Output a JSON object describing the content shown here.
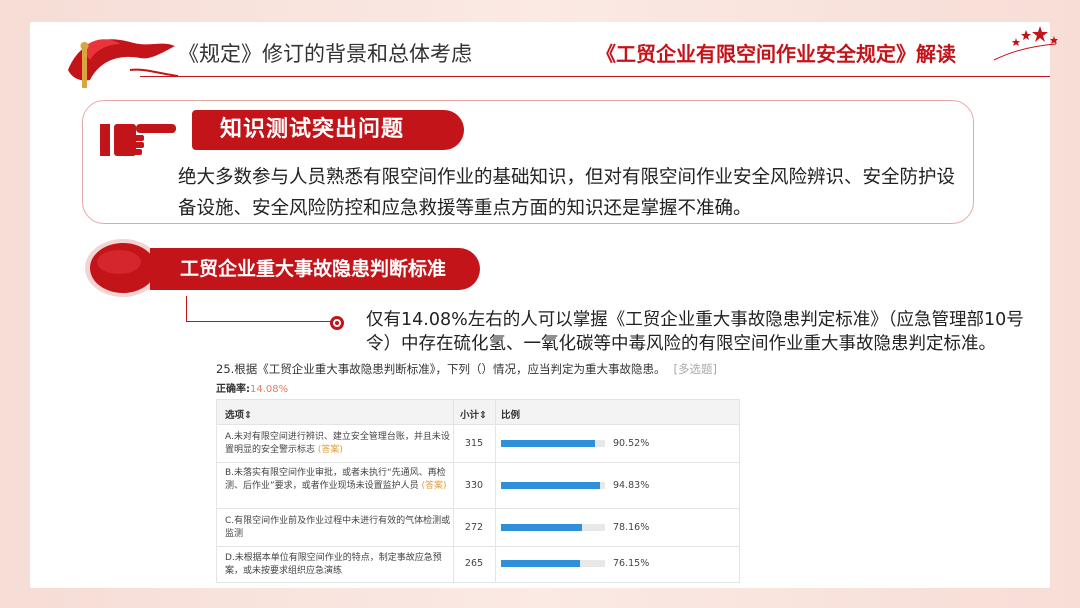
{
  "header": {
    "section_title": "《规定》修订的背景和总体考虑",
    "doc_title": "《工贸企业有限空间作业安全规定》解读"
  },
  "knowledge": {
    "banner": "知识测试突出问题",
    "text": "绝大多数参与人员熟悉有限空间作业的基础知识，但对有限空间作业安全风险辨识、安全防护设备设施、安全风险防控和应急救援等重点方面的知识还是掌握不准确。"
  },
  "standard": {
    "banner": "工贸企业重大事故隐患判断标准",
    "text": "仅有14.08%左右的人可以掌握《工贸企业重大事故隐患判定标准》（应急管理部10号令）中存在硫化氢、一氧化碳等中毒风险的有限空间作业重大事故隐患判定标准。"
  },
  "survey": {
    "question": "25.根据《工贸企业重大事故隐患判断标准》，下列（）情况，应当判定为重大事故隐患。",
    "type_tag": "[多选题]",
    "accuracy_label": "正确率:",
    "accuracy_value": "14.08%",
    "col_option": "选项⇕",
    "col_count": "小计⇕",
    "col_ratio": "比例",
    "answer_tag": "(答案)",
    "rows": [
      {
        "text": "A.未对有限空间进行辨识、建立安全管理台账，并且未设置明显的安全警示标志",
        "is_answer": true,
        "count": "315",
        "ratio": 0.9052,
        "pct": "90.52%"
      },
      {
        "text": "B.未落实有限空间作业审批，或者未执行“先通风、再检测、后作业”要求，或者作业现场未设置监护人员",
        "is_answer": true,
        "count": "330",
        "ratio": 0.9483,
        "pct": "94.83%"
      },
      {
        "text": "C.有限空间作业前及作业过程中未进行有效的气体检测或监测",
        "is_answer": false,
        "count": "272",
        "ratio": 0.7816,
        "pct": "78.16%"
      },
      {
        "text": "D.未根据本单位有限空间作业的特点，制定事故应急预案，或未按要求组织应急演练",
        "is_answer": false,
        "count": "265",
        "ratio": 0.7615,
        "pct": "76.15%"
      }
    ]
  },
  "colors": {
    "brand_red": "#c3141a",
    "bar_blue": "#2f8fd8",
    "accent_orange": "#e87a5a"
  }
}
